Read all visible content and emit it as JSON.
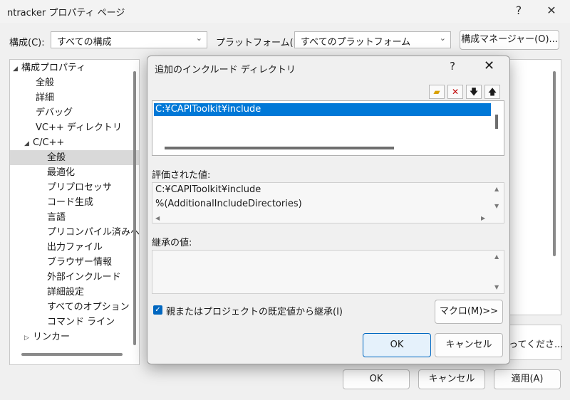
{
  "window": {
    "title": "ntracker プロパティ ページ",
    "help": "?",
    "close": "✕"
  },
  "config": {
    "config_label": "構成(C):",
    "config_value": "すべての構成",
    "platform_label": "プラットフォーム(P):",
    "platform_value": "すべてのプラットフォーム",
    "manager_button": "構成マネージャー(O)..."
  },
  "tree": {
    "root": "構成プロパティ",
    "items": [
      "全般",
      "詳細",
      "デバッグ",
      "VC++ ディレクトリ"
    ],
    "cpp": "C/C++",
    "cpp_items": [
      "全般",
      "最適化",
      "プリプロセッサ",
      "コード生成",
      "言語",
      "プリコンパイル済みヘッ",
      "出力ファイル",
      "ブラウザー情報",
      "外部インクルード",
      "詳細設定",
      "すべてのオプション",
      "コマンド ライン"
    ],
    "linker": "リンカー"
  },
  "right": {
    "desc_text": "ってくださ..."
  },
  "footer": {
    "ok": "OK",
    "cancel": "キャンセル",
    "apply": "適用(A)"
  },
  "dialog": {
    "title": "追加のインクルード ディレクトリ",
    "help": "?",
    "close": "✕",
    "toolbar_icons": [
      "new-folder-icon",
      "delete-icon",
      "move-down-icon",
      "move-up-icon"
    ],
    "list_items": [
      "C:¥CAPIToolkit¥include"
    ],
    "evaluated_label": "評価された値:",
    "evaluated_lines": [
      "C:¥CAPIToolkit¥include",
      "%(AdditionalIncludeDirectories)"
    ],
    "inherited_label": "継承の値:",
    "inherit_checkbox_label": "親またはプロジェクトの既定値から継承(I)",
    "inherit_checked": true,
    "macro_button": "マクロ(M)>>",
    "ok": "OK",
    "cancel": "キャンセル"
  }
}
